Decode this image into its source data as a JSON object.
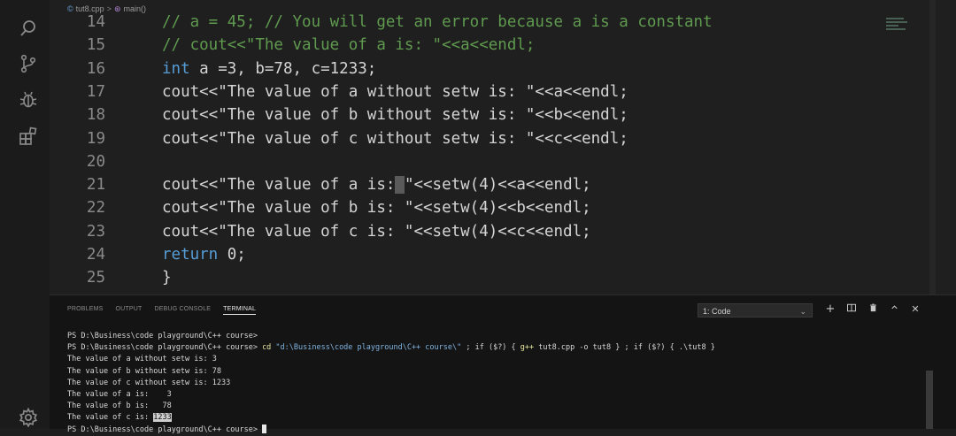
{
  "breadcrumb": {
    "file": "tut8.cpp",
    "symbol": "main()"
  },
  "activity": {
    "icons": [
      "search-icon",
      "source-control-icon",
      "debug-icon",
      "extensions-icon",
      "settings-gear-icon"
    ]
  },
  "editor": {
    "lines": [
      {
        "n": "14",
        "segs": [
          {
            "t": "// a = 45; // You will get an error because a is a constant",
            "c": "cmt"
          }
        ]
      },
      {
        "n": "15",
        "segs": [
          {
            "t": "// cout<<\"The value of a is: \"<<a<<endl;",
            "c": "cmt"
          }
        ]
      },
      {
        "n": "16",
        "segs": [
          {
            "t": "int",
            "c": "kw"
          },
          {
            "t": " a =3, b=78, c=1233;",
            "c": ""
          }
        ]
      },
      {
        "n": "17",
        "segs": [
          {
            "t": "cout<<\"The value of a without setw is: \"<<a<<endl;",
            "c": ""
          }
        ]
      },
      {
        "n": "18",
        "segs": [
          {
            "t": "cout<<\"The value of b without setw is: \"<<b<<endl;",
            "c": ""
          }
        ]
      },
      {
        "n": "19",
        "segs": [
          {
            "t": "cout<<\"The value of c without setw is: \"<<c<<endl;",
            "c": ""
          }
        ]
      },
      {
        "n": "20",
        "segs": []
      },
      {
        "n": "21",
        "segs": [
          {
            "t": "cout<<\"The value of a is:",
            "c": ""
          },
          {
            "t": " ",
            "c": "cursor-blk"
          },
          {
            "t": "\"<<setw(4)<<a<<endl;",
            "c": ""
          }
        ]
      },
      {
        "n": "22",
        "segs": [
          {
            "t": "cout<<\"The value of b is: \"<<setw(4)<<b<<endl;",
            "c": ""
          }
        ]
      },
      {
        "n": "23",
        "segs": [
          {
            "t": "cout<<\"The value of c is: \"<<setw(4)<<c<<endl;",
            "c": ""
          }
        ]
      },
      {
        "n": "24",
        "segs": [
          {
            "t": "return",
            "c": "kw"
          },
          {
            "t": " 0;",
            "c": ""
          }
        ]
      },
      {
        "n": "25",
        "segs": [
          {
            "t": "}",
            "c": ""
          }
        ]
      }
    ]
  },
  "panel": {
    "tabs": [
      {
        "label": "PROBLEMS",
        "active": false
      },
      {
        "label": "OUTPUT",
        "active": false
      },
      {
        "label": "DEBUG CONSOLE",
        "active": false
      },
      {
        "label": "TERMINAL",
        "active": true
      }
    ],
    "terminal_select": "1: Code",
    "icons": [
      "add-icon",
      "split-icon",
      "trash-icon",
      "chevron-up-icon",
      "close-icon"
    ]
  },
  "terminal": {
    "lines": [
      {
        "segs": [
          {
            "t": "PS D:\\Business\\code playground\\C++ course>",
            "c": ""
          }
        ]
      },
      {
        "segs": [
          {
            "t": "PS D:\\Business\\code playground\\C++ course> ",
            "c": ""
          },
          {
            "t": "cd ",
            "c": "t-cmd"
          },
          {
            "t": "\"d:\\Business\\code playground\\C++ course\\\"",
            "c": "t-str"
          },
          {
            "t": " ; if ($?) { ",
            "c": ""
          },
          {
            "t": "g++",
            "c": "t-cmd"
          },
          {
            "t": " tut8.cpp -o tut8 } ; if ($?) { .\\tut8 }",
            "c": ""
          }
        ]
      },
      {
        "segs": [
          {
            "t": "The value of a without setw is: 3",
            "c": ""
          }
        ]
      },
      {
        "segs": [
          {
            "t": "The value of b without setw is: 78",
            "c": ""
          }
        ]
      },
      {
        "segs": [
          {
            "t": "The value of c without setw is: 1233",
            "c": ""
          }
        ]
      },
      {
        "segs": [
          {
            "t": "The value of a is:    3",
            "c": ""
          }
        ]
      },
      {
        "segs": [
          {
            "t": "The value of b is:   78",
            "c": ""
          }
        ]
      },
      {
        "segs": [
          {
            "t": "The value of c is: ",
            "c": ""
          },
          {
            "t": "1233",
            "c": "t-sel"
          }
        ]
      },
      {
        "segs": [
          {
            "t": "PS D:\\Business\\code playground\\C++ course> ",
            "c": ""
          }
        ]
      }
    ]
  }
}
